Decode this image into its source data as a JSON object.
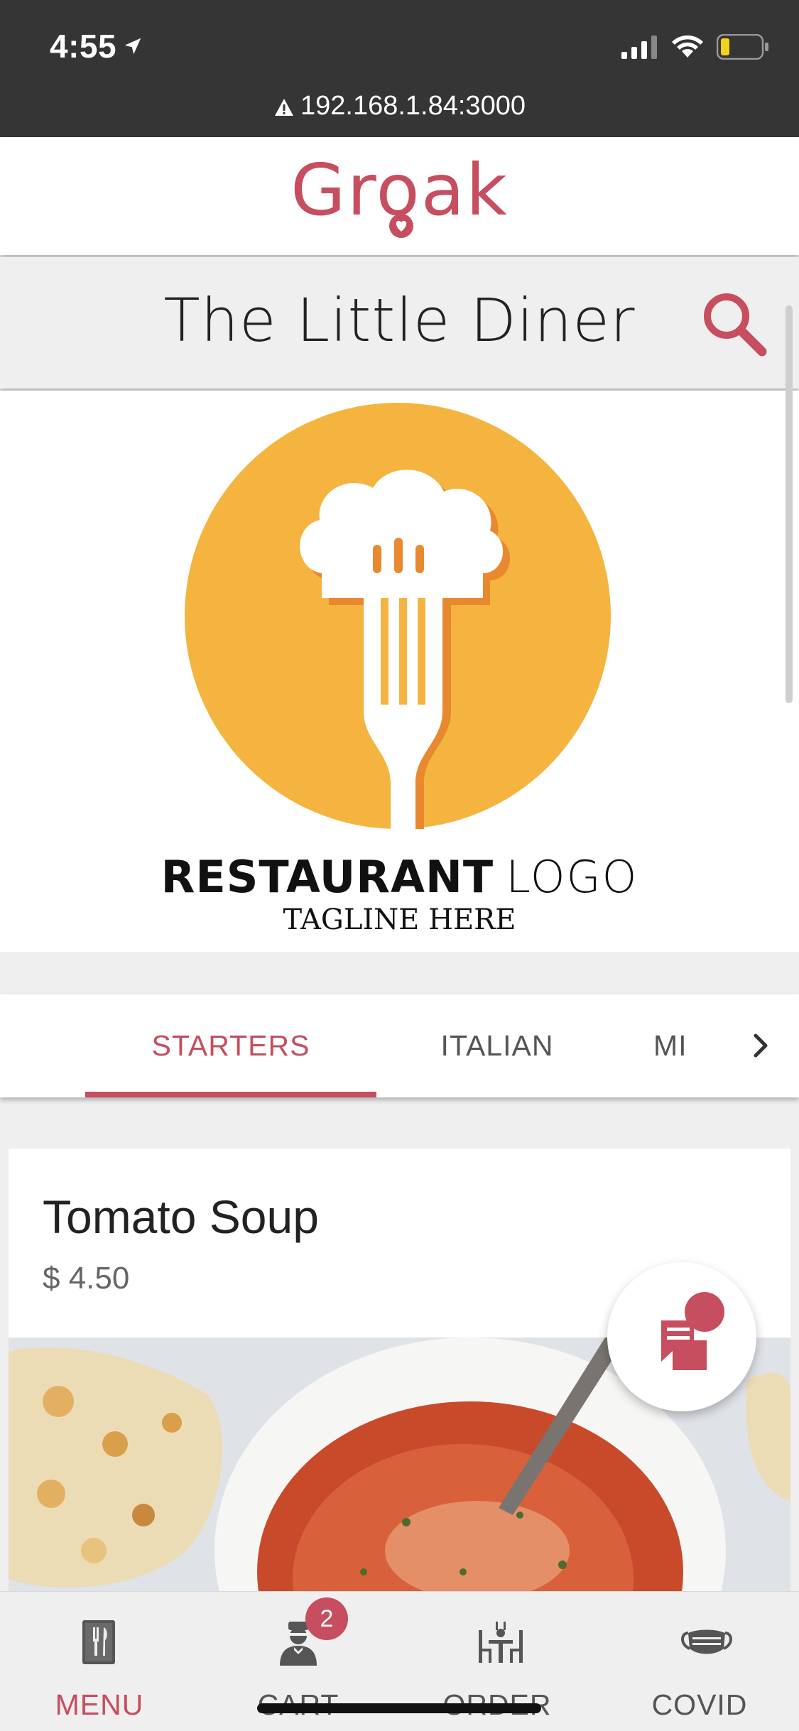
{
  "status_bar": {
    "time": "4:55",
    "url": "192.168.1.84:3000"
  },
  "brand": {
    "name": "Groak",
    "color": "#c64e5f"
  },
  "restaurant": {
    "name": "The Little Diner",
    "logo_name_bold": "RESTAURANT",
    "logo_name_light": "LOGO",
    "logo_tagline": "TAGLINE HERE"
  },
  "tabs": [
    {
      "label": "STARTERS",
      "active": true
    },
    {
      "label": "ITALIAN",
      "active": false
    },
    {
      "label": "MI",
      "active": false
    }
  ],
  "item": {
    "name": "Tomato Soup",
    "price": "$ 4.50"
  },
  "bottom_nav": [
    {
      "label": "MENU",
      "icon": "menu-book-icon",
      "active": true
    },
    {
      "label": "CART",
      "icon": "waiter-icon",
      "badge": "2",
      "active": false
    },
    {
      "label": "ORDER",
      "icon": "dining-table-icon",
      "active": false
    },
    {
      "label": "COVID",
      "icon": "face-mask-icon",
      "active": false
    }
  ],
  "colors": {
    "accent": "#c64e5f",
    "logo_yellow": "#f4b43f",
    "status_bg": "#353535"
  }
}
